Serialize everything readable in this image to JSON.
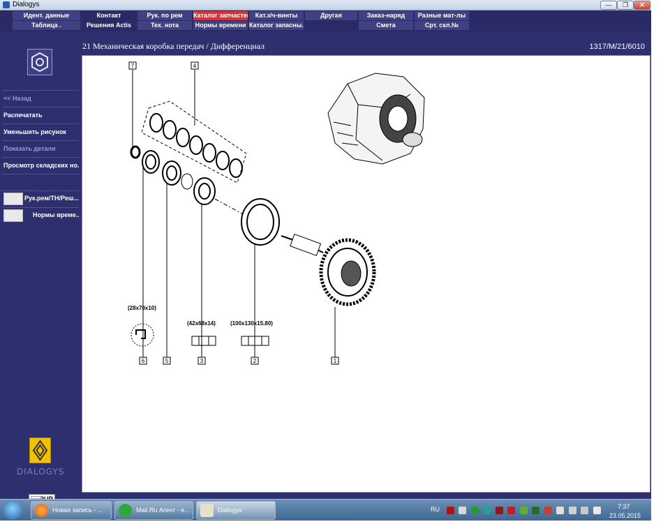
{
  "window": {
    "title": "Dialogys",
    "minimize": "—",
    "maximize": "❐",
    "close": "✕"
  },
  "menu": {
    "row1": [
      "Идент. данные",
      "Контакт",
      "Рук. по рем",
      "Каталог запчастей",
      "Кат.з/ч-винты",
      "Другая",
      "Заказ-наряд",
      "Разные мат-лы"
    ],
    "row2": [
      "Таблица .",
      "Решения Actis",
      "Тех. нота",
      "Нормы времени",
      "Каталог запасны...",
      "",
      "Смета",
      "Срт. скл.№"
    ],
    "active": "Каталог запчастей"
  },
  "sidebar": {
    "links": [
      "<< Назад",
      "Распечатать",
      "Уменьшить рисунок",
      "Показать детали",
      "Просмотр складских но..."
    ],
    "docs": [
      "Рук.рем/ТН/Реш....",
      "Нормы време..."
    ],
    "brand": "DIALOGYS",
    "currency": "RUR"
  },
  "header": {
    "title": "21 Механическая коробка передач / Дифференциал",
    "code": "1317/M/21/6010"
  },
  "diagram": {
    "callouts": [
      "7",
      "4",
      "6",
      "5",
      "3",
      "2",
      "1"
    ],
    "dimensions": [
      "(28x70x10)",
      "(42x68x14)",
      "(100x130x15.80)"
    ]
  },
  "taskbar": {
    "tasks": [
      "Новая запись - ...",
      "Mail.Ru Агент - е...",
      "Dialogys"
    ],
    "lang": "RU",
    "time": "7:37",
    "date": "23.05.2015"
  },
  "colors": {
    "menu_bg": "#2a2b66",
    "active_tab": "#d8333a",
    "sidebar_rule": "#b03040"
  }
}
